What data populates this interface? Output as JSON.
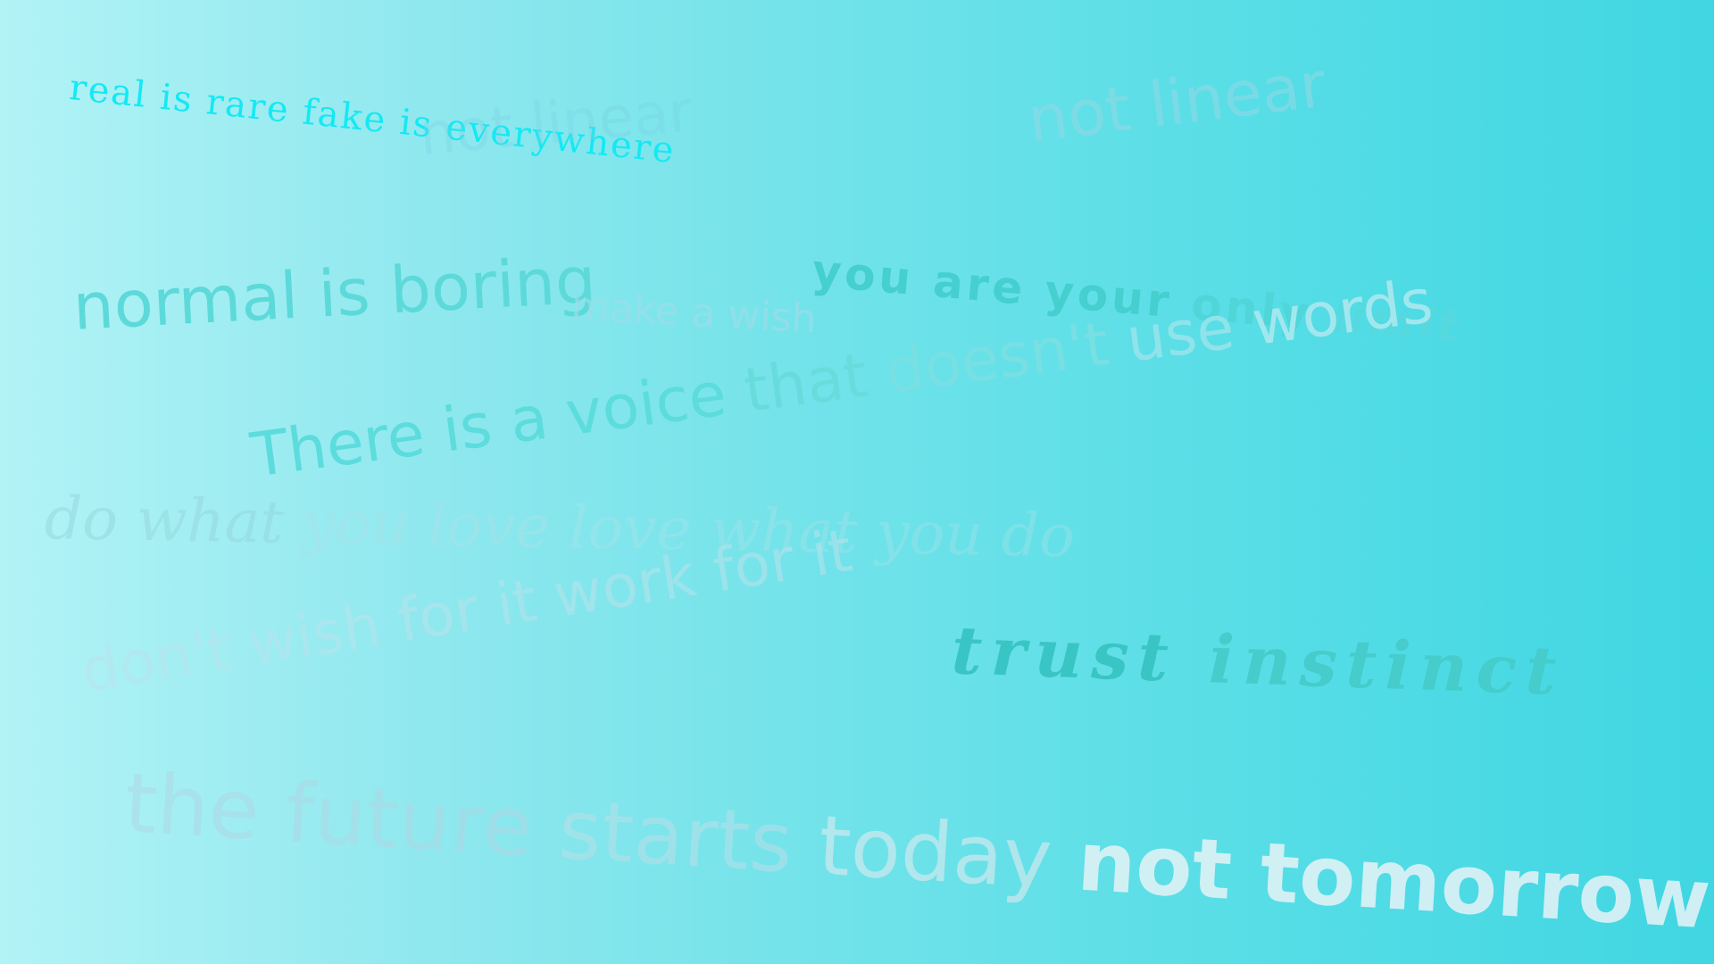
{
  "phrases": {
    "real": "real is rare fake is everywhere",
    "notlinear_left": "not linear",
    "notlinear_right": "not linear",
    "limit": {
      "w1": "you are your",
      "w2": "only",
      "w3": "limit"
    },
    "normal": "normal is boring",
    "wish": "make a wish",
    "voice": {
      "part1": "There is a voice",
      "part2": "that",
      "part3": "doesn't",
      "part4": "use",
      "part5": "words"
    },
    "dowhat": {
      "part1": "do what",
      "part2": "you love",
      "part3": "love what you do"
    },
    "dontwish": "don't wish for it work for it",
    "trust": {
      "w1": "trust",
      "w2": "instinct"
    },
    "future": {
      "part1": "the future",
      "part2": "starts",
      "part3": "today",
      "part4": "not tomorrow"
    }
  },
  "colors": {
    "background_left": "#b2f3f6",
    "background_right": "#40d6e2",
    "highlight": "#14e9f3"
  }
}
